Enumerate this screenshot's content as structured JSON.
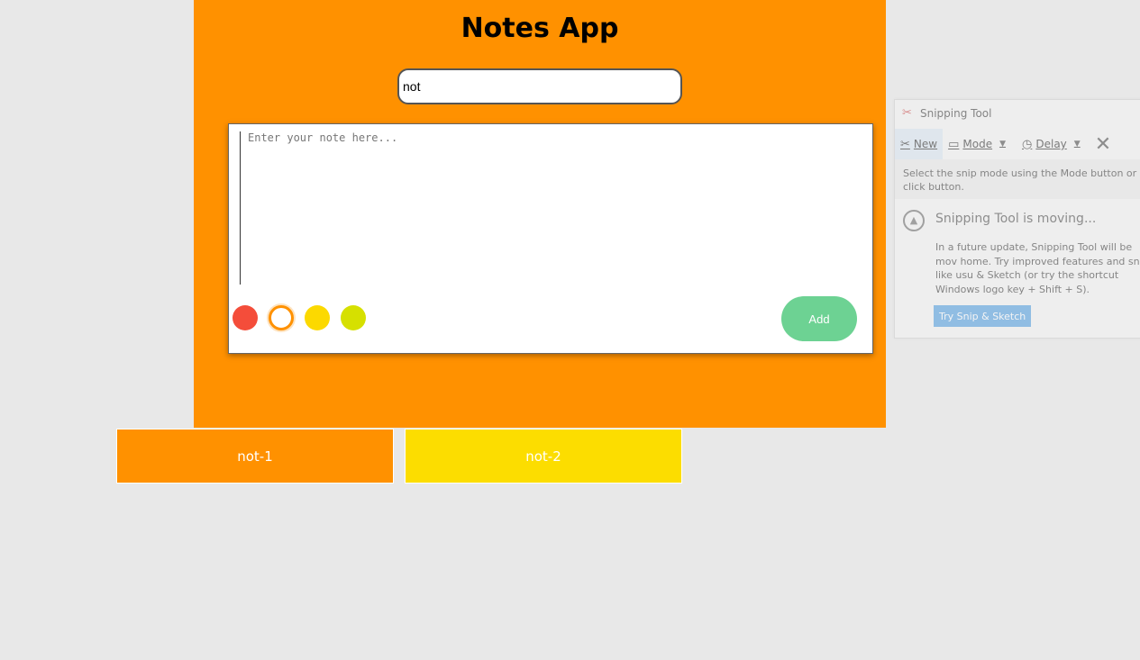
{
  "app": {
    "title": "Notes App",
    "search": {
      "value": "not",
      "placeholder": ""
    },
    "composer": {
      "placeholder": "Enter your note here...",
      "value": "",
      "colors": [
        {
          "name": "red",
          "hex": "#f44d3a",
          "selected": false
        },
        {
          "name": "orange",
          "hex": "#ff9100",
          "selected": true
        },
        {
          "name": "yellow",
          "hex": "#fcd900",
          "selected": false
        },
        {
          "name": "lime",
          "hex": "#d6e000",
          "selected": false
        }
      ],
      "add_label": "Add"
    },
    "accent_color": "#ff9100",
    "notes": [
      {
        "text": "not-1",
        "color": "#ff9100"
      },
      {
        "text": "not-2",
        "color": "#fcdd00"
      }
    ]
  },
  "snipping_tool": {
    "title": "Snipping Tool",
    "toolbar": {
      "new_label": "New",
      "mode_label": "Mode",
      "delay_label": "Delay",
      "cancel_icon": "close-icon"
    },
    "hint": "Select the snip mode using the Mode button or click button.",
    "moving_title": "Snipping Tool is moving...",
    "moving_body": "In a future update, Snipping Tool will be mov home. Try improved features and snip like usu & Sketch (or try the shortcut Windows logo key + Shift + S).",
    "try_button_label": "Try Snip & Sketch"
  }
}
